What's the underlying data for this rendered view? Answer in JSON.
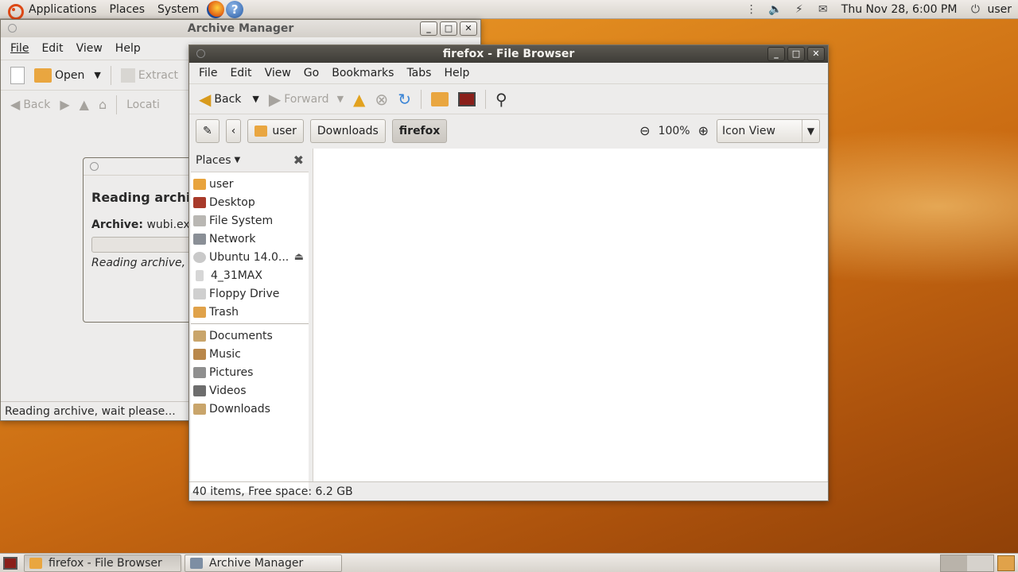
{
  "top_panel": {
    "menus": [
      "Applications",
      "Places",
      "System"
    ],
    "clock": "Thu Nov 28,  6:00 PM",
    "user": "user"
  },
  "archive_manager": {
    "title": "Archive Manager",
    "menus": [
      "File",
      "Edit",
      "View",
      "Help"
    ],
    "toolbar": {
      "open": "Open",
      "extract": "Extract",
      "back": "Back",
      "location": "Locati"
    },
    "dialog": {
      "heading": "Reading archi",
      "archive_label": "Archive:",
      "archive_value": "wubi.exe",
      "message": "Reading archive, w"
    },
    "status": "Reading archive, wait please..."
  },
  "file_browser": {
    "title": "firefox - File Browser",
    "menus": [
      "File",
      "Edit",
      "View",
      "Go",
      "Bookmarks",
      "Tabs",
      "Help"
    ],
    "toolbar": {
      "back": "Back",
      "forward": "Forward"
    },
    "path": [
      "user",
      "Downloads",
      "firefox"
    ],
    "zoom": "100%",
    "view_mode": "Icon View",
    "sidebar": {
      "header": "Places",
      "devices": [
        {
          "label": "user",
          "color": "#e8a33c"
        },
        {
          "label": "Desktop",
          "color": "#a83a2a"
        },
        {
          "label": "File System",
          "color": "#b9b7b3"
        },
        {
          "label": "Network",
          "color": "#8a8f96"
        },
        {
          "label": "Ubuntu 14.0...",
          "color": "#c9c9c9"
        },
        {
          "label": "4_31MAX",
          "color": "#d6d6d6"
        },
        {
          "label": "Floppy Drive",
          "color": "#cfcfcf"
        },
        {
          "label": "Trash",
          "color": "#e0a24a"
        }
      ],
      "bookmarks": [
        {
          "label": "Documents",
          "color": "#c9a56b"
        },
        {
          "label": "Music",
          "color": "#b9874a"
        },
        {
          "label": "Pictures",
          "color": "#8f8f8f"
        },
        {
          "label": "Videos",
          "color": "#6d6d6d"
        },
        {
          "label": "Downloads",
          "color": "#c9a56b"
        }
      ]
    },
    "status": "40 items, Free space: 6.2 GB"
  },
  "taskbar": {
    "tasks": [
      "firefox - File Browser",
      "Archive Manager"
    ]
  },
  "colors": {
    "accent": "#dd4814",
    "titlebar_active": "#4a4842"
  }
}
